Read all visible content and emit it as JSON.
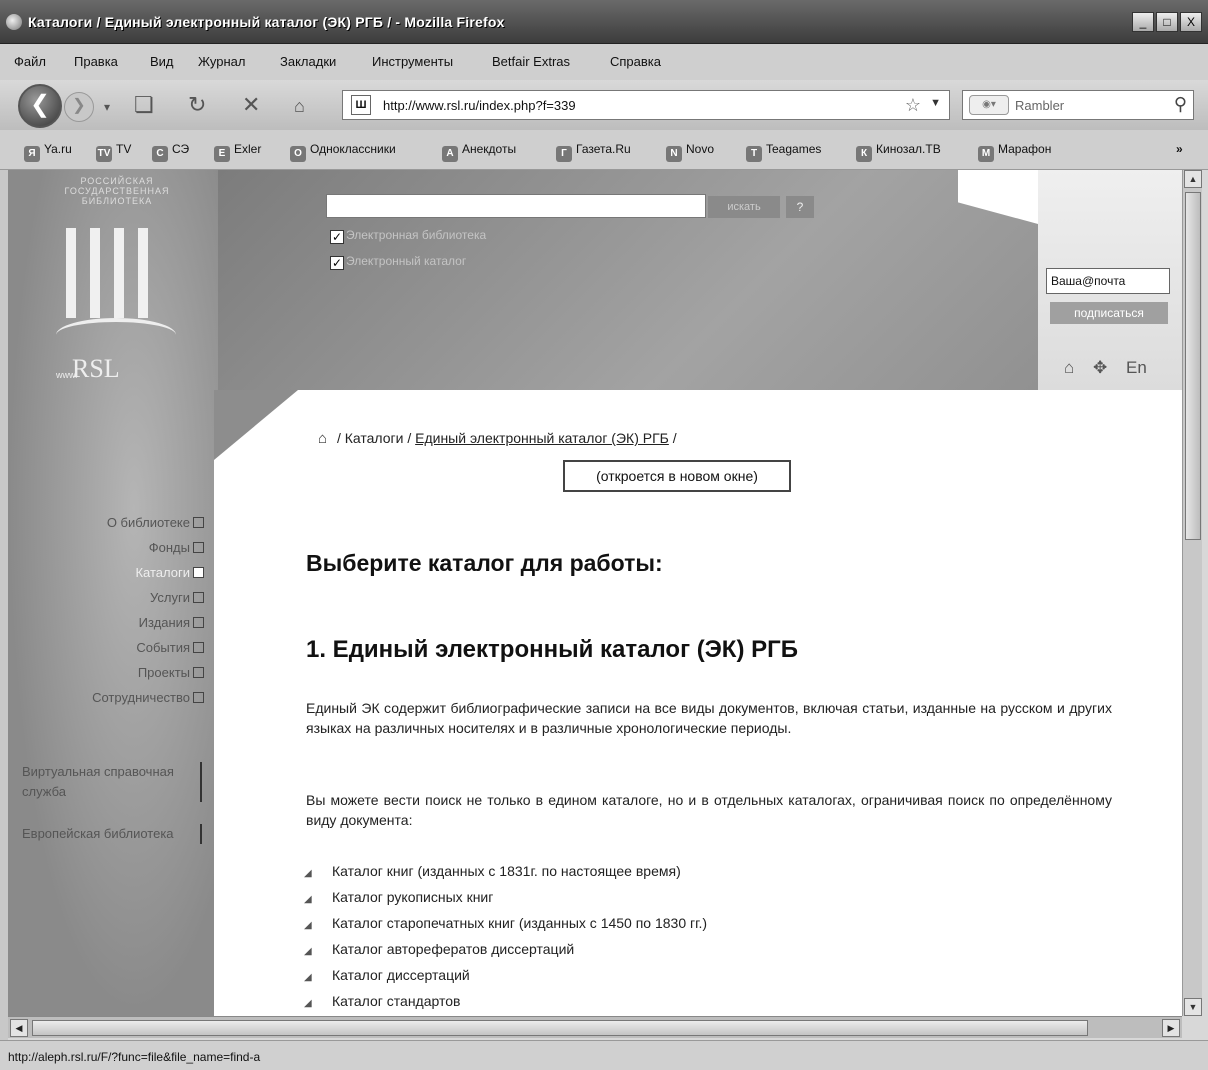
{
  "window": {
    "title": "Каталоги / Единый электронный каталог (ЭК) РГБ / - Mozilla Firefox",
    "buttons": [
      "_",
      "□",
      "X"
    ]
  },
  "menu": [
    "Файл",
    "Правка",
    "Вид",
    "Журнал",
    "Закладки",
    "Инструменты",
    "Betfair Extras",
    "Справка"
  ],
  "nav": {
    "url": "http://www.rsl.ru/index.php?f=339",
    "search_placeholder": "Rambler"
  },
  "bookmarks": [
    {
      "label": "Ya.ru",
      "icon": "Я"
    },
    {
      "label": "TV",
      "icon": "TV"
    },
    {
      "label": "СЭ",
      "icon": "С"
    },
    {
      "label": "Exler",
      "icon": "E"
    },
    {
      "label": "Одноклассники",
      "icon": "О"
    },
    {
      "label": "Анекдоты",
      "icon": "А"
    },
    {
      "label": "Газета.Ru",
      "icon": "Г"
    },
    {
      "label": "Novo",
      "icon": "N"
    },
    {
      "label": "Teagames",
      "icon": "T"
    },
    {
      "label": "Кинозал.ТВ",
      "icon": "К"
    },
    {
      "label": "Марафон",
      "icon": "М"
    }
  ],
  "site": {
    "logo_text": "Российская государственная библиотека",
    "logo_rsl": "RSL",
    "logo_www": "www.",
    "search_button": "искать",
    "help_button": "?",
    "checkbox_el_library": "Электронная библиотека",
    "checkbox_el_catalog": "Электронный каталог",
    "email_value": "Ваша@почта",
    "subscribe_label": "подписаться",
    "lang_label": "En"
  },
  "left_nav": [
    {
      "label": "О библиотеке",
      "active": false
    },
    {
      "label": "Фонды",
      "active": false
    },
    {
      "label": "Каталоги",
      "active": true
    },
    {
      "label": "Услуги",
      "active": false
    },
    {
      "label": "Издания",
      "active": false
    },
    {
      "label": "События",
      "active": false
    },
    {
      "label": "Проекты",
      "active": false
    },
    {
      "label": "Сотрудничество",
      "active": false
    }
  ],
  "side_boxes": [
    "Виртуальная справочная служба",
    "Европейская библиотека"
  ],
  "breadcrumb": {
    "part1": "Каталоги",
    "part2": "Единый электронный каталог (ЭК) РГБ",
    "sep": "/"
  },
  "new_window_label": "(откроется в новом окне)",
  "main": {
    "heading": "Выберите каталог для работы:",
    "section_title": "1. Единый электронный каталог (ЭК) РГБ",
    "para1": "Единый ЭК содержит библиографические записи на все виды документов, включая статьи, изданные на русском и других языках на различных носителях и в различные хронологические периоды.",
    "para2": "Вы можете вести поиск не только в едином каталоге, но и в отдельных каталогах, ограничивая поиск по определённому виду документа:",
    "catalogs": [
      "Каталог книг (изданных с 1831г. по настоящее время)",
      "Каталог рукописных книг",
      "Каталог старопечатных книг (изданных с 1450 по 1830 гг.)",
      "Каталог авторефератов диссертаций",
      "Каталог диссертаций",
      "Каталог стандартов"
    ]
  },
  "status_text": "http://aleph.rsl.ru/F/?func=file&file_name=find-a"
}
